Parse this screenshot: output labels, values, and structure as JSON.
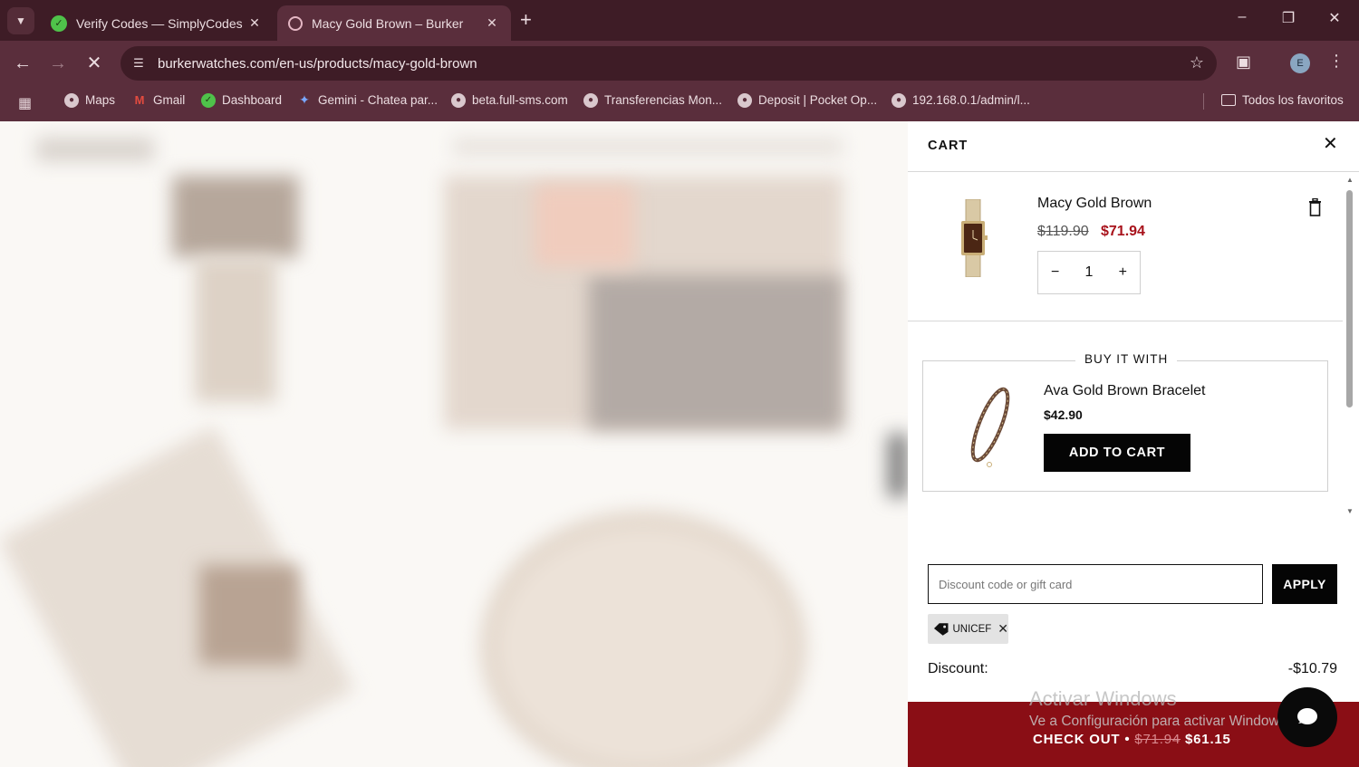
{
  "browser": {
    "tabs": [
      {
        "title": "Verify Codes — SimplyCodes",
        "active": false
      },
      {
        "title": "Macy Gold Brown – Burker",
        "active": true
      }
    ],
    "url": "burkerwatches.com/en-us/products/macy-gold-brown",
    "profile_initial": "E",
    "bookmarks": [
      {
        "label": "Maps",
        "icon": "globe-icon"
      },
      {
        "label": "Gmail",
        "icon": "gmail-icon"
      },
      {
        "label": "Dashboard",
        "icon": "check-icon"
      },
      {
        "label": "Gemini - Chatea par...",
        "icon": "gemini-icon"
      },
      {
        "label": "beta.full-sms.com",
        "icon": "globe-icon"
      },
      {
        "label": "Transferencias Mon...",
        "icon": "globe-icon"
      },
      {
        "label": "Deposit | Pocket Op...",
        "icon": "globe-icon"
      },
      {
        "label": "192.168.0.1/admin/l...",
        "icon": "globe-icon"
      }
    ],
    "all_bookmarks": "Todos los favoritos"
  },
  "cart": {
    "title": "CART",
    "item": {
      "name": "Macy Gold Brown",
      "price_original": "$119.90",
      "price_sale": "$71.94",
      "quantity": "1",
      "minus": "−",
      "plus": "+"
    },
    "upsell": {
      "heading": "BUY IT WITH",
      "name": "Ava Gold Brown Bracelet",
      "price": "$42.90",
      "button": "ADD TO CART"
    },
    "discount": {
      "placeholder": "Discount code or gift card",
      "apply": "APPLY",
      "code": "UNICEF",
      "label": "Discount:",
      "value": "-$10.79"
    },
    "checkout": {
      "label": "CHECK OUT •",
      "old_total": "$71.94",
      "new_total": "$61.15"
    }
  },
  "watermark": {
    "title": "Activar Windows",
    "subtitle": "Ve a Configuración para activar Windows."
  },
  "colors": {
    "chrome_dark": "#3e1c26",
    "chrome_mid": "#5a2e3c",
    "sale_red": "#a8121b",
    "checkout_red": "#8a0e15"
  }
}
